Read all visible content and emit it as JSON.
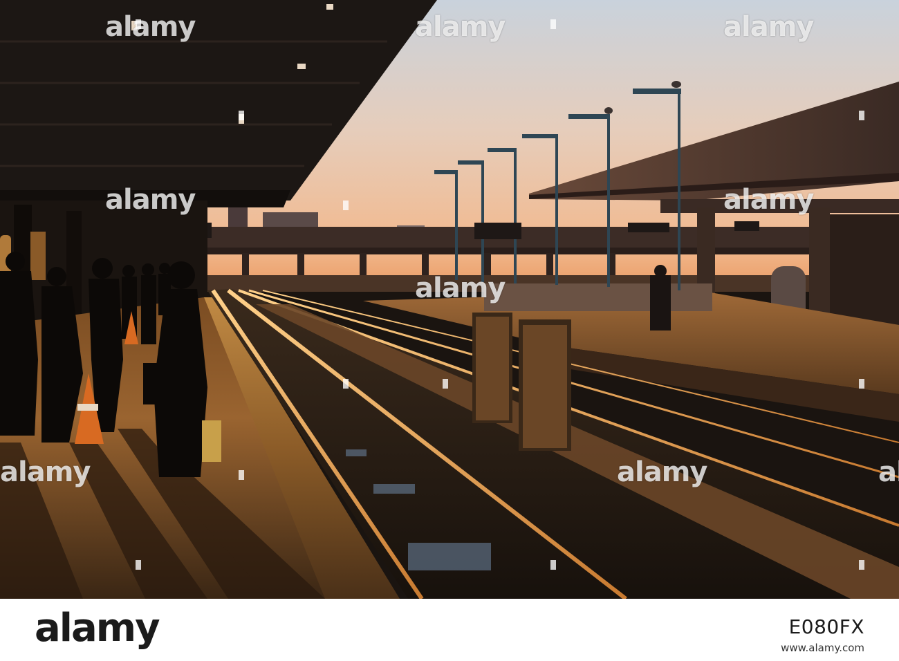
{
  "watermark": {
    "text": "alamy"
  },
  "banner": {
    "logo": "alamy",
    "image_id": "E080FX",
    "url": "www.alamy.com"
  }
}
